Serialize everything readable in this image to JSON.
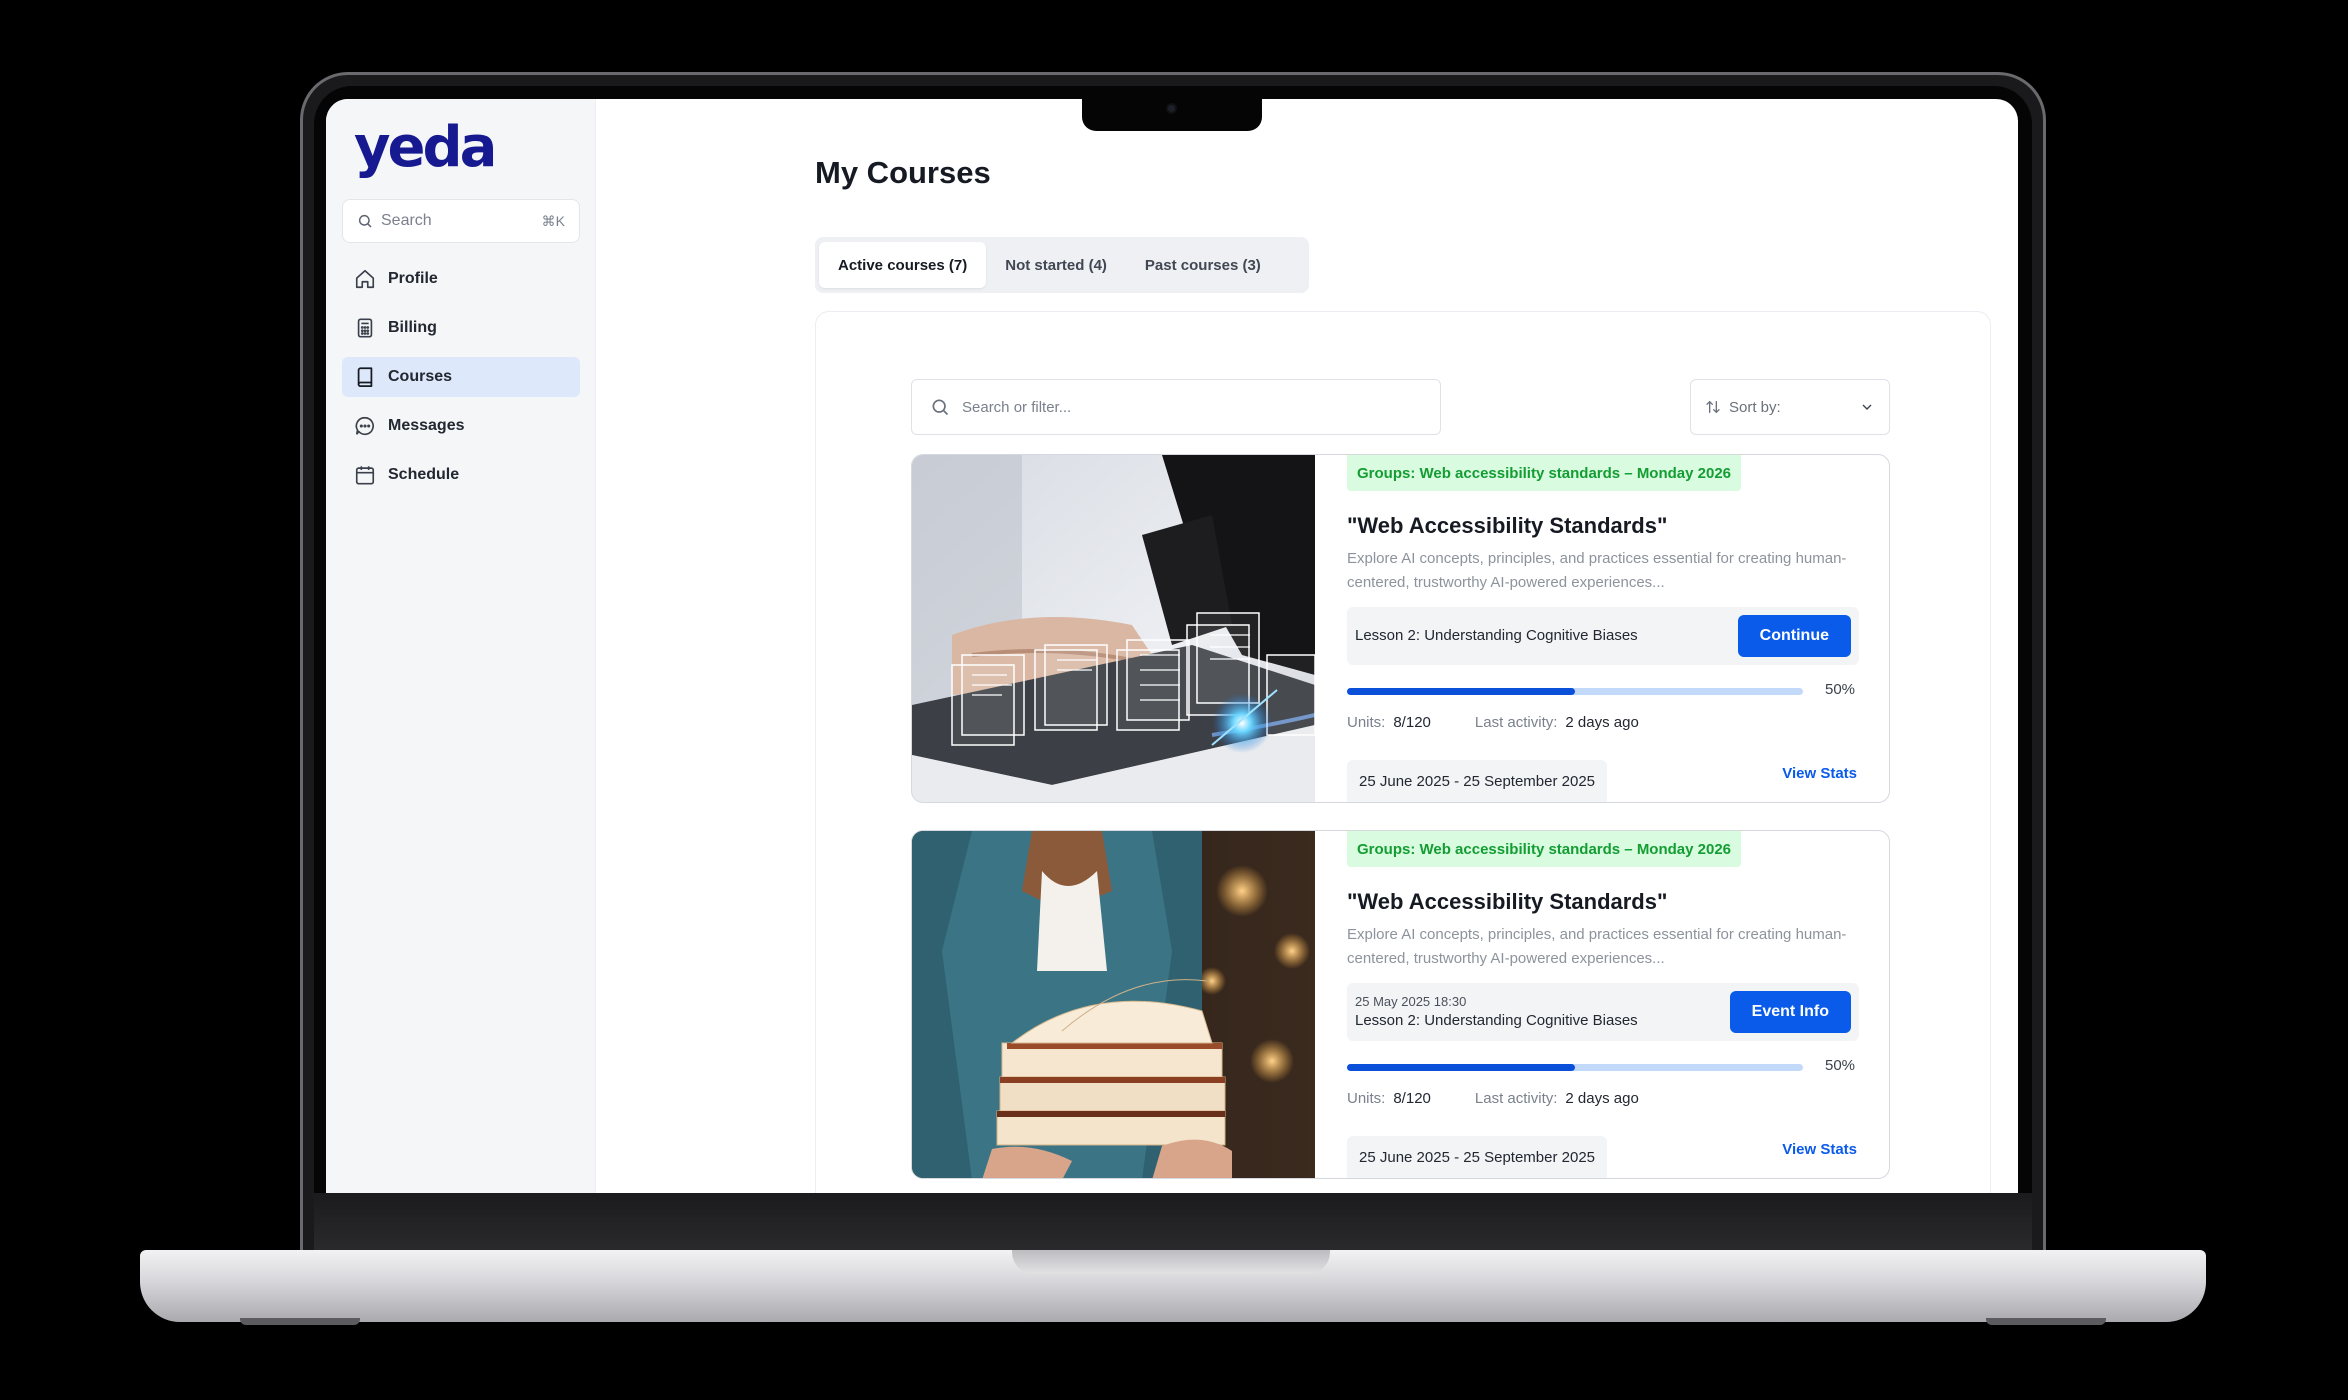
{
  "app": {
    "logo_text": "yeda",
    "brand_color": "#16198f",
    "accent_color": "#0a5bea"
  },
  "sidebar": {
    "search": {
      "placeholder": "Search",
      "shortcut": "⌘K"
    },
    "items": [
      {
        "label": "Profile",
        "icon": "home-icon",
        "active": false
      },
      {
        "label": "Billing",
        "icon": "calculator-icon",
        "active": false
      },
      {
        "label": "Courses",
        "icon": "book-icon",
        "active": true
      },
      {
        "label": "Messages",
        "icon": "chat-bubble-icon",
        "active": false
      },
      {
        "label": "Schedule",
        "icon": "calendar-icon",
        "active": false
      }
    ]
  },
  "main": {
    "title": "My Courses",
    "tabs": [
      {
        "label": "Active courses (7)",
        "active": true
      },
      {
        "label": "Not started (4)",
        "active": false
      },
      {
        "label": "Past courses (3)",
        "active": false
      }
    ],
    "filter": {
      "placeholder": "Search or filter..."
    },
    "sort": {
      "label": "Sort by:"
    },
    "courses": [
      {
        "group": "Groups: Web accessibility standards – Monday 2026",
        "title": "\"Web Accessibility Standards\"",
        "description": "Explore AI concepts, principles, and practices essential for creating human-centered, trustworthy AI-powered experiences...",
        "lesson_meta": "",
        "lesson": "Lesson 2: Understanding Cognitive Biases",
        "action": "Continue",
        "progress_percent": 50,
        "progress_label": "50%",
        "units_label": "Units:",
        "units": "8/120",
        "activity_label": "Last activity:",
        "last_activity": "2 days ago",
        "dates": "25 June 2025 - 25 September 2025",
        "stats_link": "View Stats",
        "image": "person-typing-laptop-documents"
      },
      {
        "group": "Groups: Web accessibility standards – Monday 2026",
        "title": "\"Web Accessibility Standards\"",
        "description": "Explore AI concepts, principles, and practices essential for creating human-centered, trustworthy AI-powered experiences...",
        "lesson_meta": "25 May 2025 18:30",
        "lesson": "Lesson 2: Understanding Cognitive Biases",
        "action": "Event Info",
        "progress_percent": 50,
        "progress_label": "50%",
        "units_label": "Units:",
        "units": "8/120",
        "activity_label": "Last activity:",
        "last_activity": "2 days ago",
        "dates": "25 June 2025 - 25 September 2025",
        "stats_link": "View Stats",
        "image": "person-holding-book-stack"
      }
    ]
  }
}
